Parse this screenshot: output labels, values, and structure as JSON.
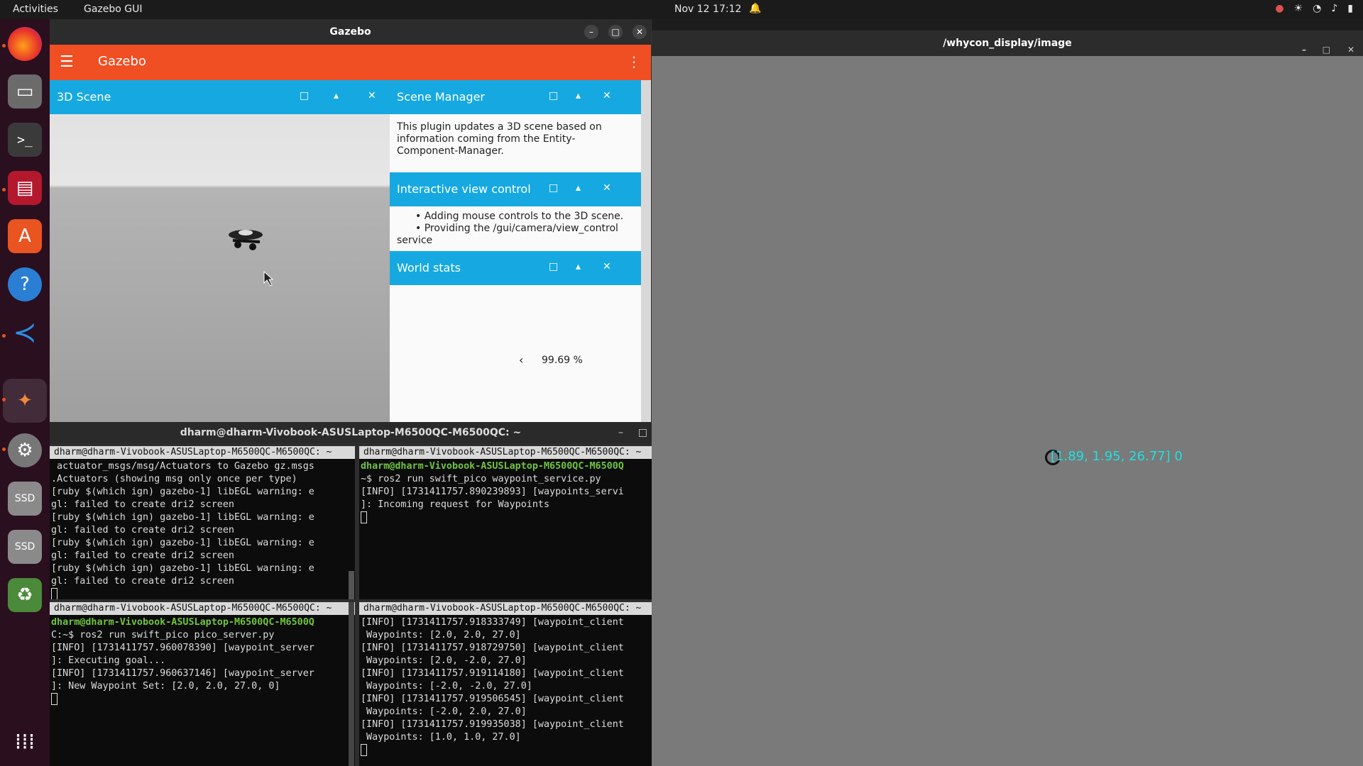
{
  "topbar": {
    "activities": "Activities",
    "app_name": "Gazebo GUI",
    "clock": "Nov 12  17:12"
  },
  "dock": {
    "items": [
      "firefox-icon",
      "files-icon",
      "terminal-icon",
      "screen-recorder-icon",
      "app-center-icon",
      "help-icon",
      "vscode-icon",
      "gazebo-icon",
      "settings-icon",
      "ssd-icon",
      "ssd-icon",
      "trash-icon",
      "app-grid-icon"
    ]
  },
  "gazebo": {
    "window_title": "Gazebo",
    "app_title": "Gazebo",
    "scene_panel": {
      "title": "3D Scene"
    },
    "scene_manager": {
      "title": "Scene Manager",
      "text": "This plugin updates a 3D scene based on information coming from the Entity-Component-Manager."
    },
    "view_control": {
      "title": "Interactive view control",
      "bullet1": "Adding mouse controls to the 3D scene.",
      "bullet2": "Providing the /gui/camera/view_control",
      "bullet2_cont": "service"
    },
    "world_stats": {
      "title": "World stats",
      "arrow": "‹",
      "value": "99.69 %"
    }
  },
  "whycon": {
    "window_title": "/whycon_display/image",
    "label": "[1.89, 1.95, 26.77] 0"
  },
  "terminal": {
    "window_title": "dharm@dharm-Vivobook-ASUSLaptop-M6500QC-M6500QC: ~",
    "pane_tl": {
      "header": "dharm@dharm-Vivobook-ASUSLaptop-M6500QC-M6500QC: ~",
      "lines": [
        " actuator_msgs/msg/Actuators to Gazebo gz.msgs",
        ".Actuators (showing msg only once per type)",
        "[ruby $(which ign) gazebo-1] libEGL warning: e",
        "gl: failed to create dri2 screen",
        "[ruby $(which ign) gazebo-1] libEGL warning: e",
        "gl: failed to create dri2 screen",
        "[ruby $(which ign) gazebo-1] libEGL warning: e",
        "gl: failed to create dri2 screen",
        "[ruby $(which ign) gazebo-1] libEGL warning: e",
        "gl: failed to create dri2 screen"
      ]
    },
    "pane_tr": {
      "header": "dharm@dharm-Vivobook-ASUSLaptop-M6500QC-M6500QC: ~",
      "prompt_user": "dharm@dharm-Vivobook-ASUSLaptop-M6500QC-M6500Q",
      "prompt_tail": "~$ ros2 run swift_pico waypoint_service.py",
      "lines": [
        "[INFO] [1731411757.890239893] [waypoints_servi",
        "]: Incoming request for Waypoints"
      ]
    },
    "pane_bl": {
      "header": "dharm@dharm-Vivobook-ASUSLaptop-M6500QC-M6500QC: ~",
      "prompt_user": "dharm@dharm-Vivobook-ASUSLaptop-M6500QC-M6500Q",
      "prompt_tail": "C:~$ ros2 run swift_pico pico_server.py",
      "lines": [
        "[INFO] [1731411757.960078390] [waypoint_server",
        "]: Executing goal...",
        "[INFO] [1731411757.960637146] [waypoint_server",
        "]: New Waypoint Set: [2.0, 2.0, 27.0, 0]"
      ]
    },
    "pane_br": {
      "header": "dharm@dharm-Vivobook-ASUSLaptop-M6500QC-M6500QC: ~",
      "lines": [
        "[INFO] [1731411757.918333749] [waypoint_client",
        " Waypoints: [2.0, 2.0, 27.0]",
        "[INFO] [1731411757.918729750] [waypoint_client",
        " Waypoints: [2.0, -2.0, 27.0]",
        "[INFO] [1731411757.919114180] [waypoint_client",
        " Waypoints: [-2.0, -2.0, 27.0]",
        "[INFO] [1731411757.919506545] [waypoint_client",
        " Waypoints: [-2.0, 2.0, 27.0]",
        "[INFO] [1731411757.919935038] [waypoint_client",
        " Waypoints: [1.0, 1.0, 27.0]"
      ]
    }
  }
}
